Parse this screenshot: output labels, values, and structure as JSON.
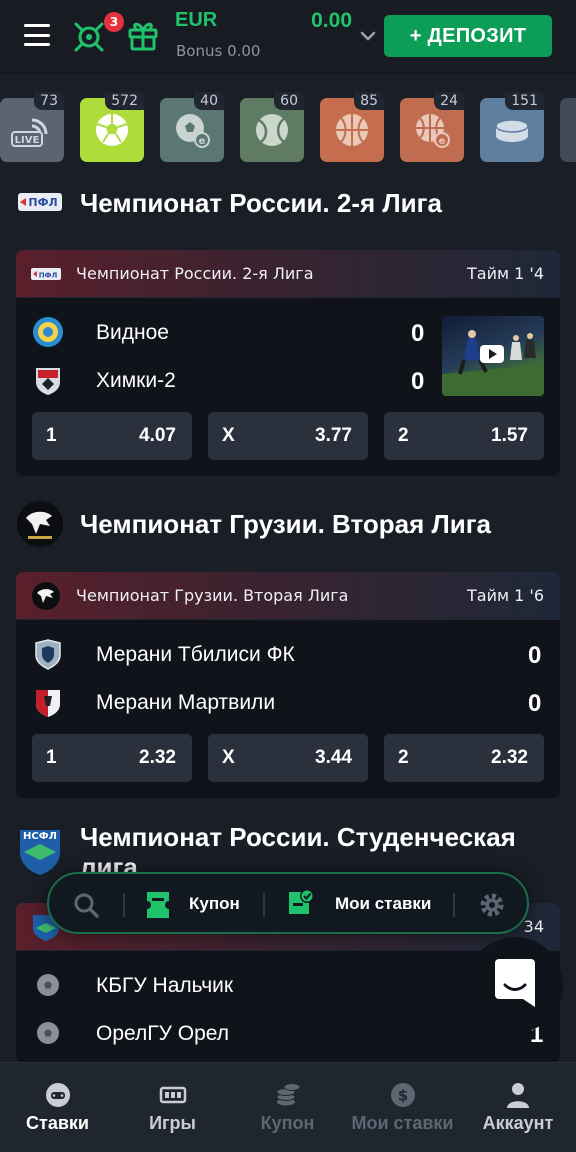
{
  "header": {
    "rewards_badge": "3",
    "currency": "EUR",
    "bonus": "Bonus 0.00",
    "balance": "0.00",
    "deposit_label": "+ ДЕПОЗИТ",
    "accent": "#1fc36b"
  },
  "sports": [
    {
      "icon": "live-icon",
      "count": "73"
    },
    {
      "icon": "football-icon",
      "count": "572"
    },
    {
      "icon": "efootball-icon",
      "count": "40"
    },
    {
      "icon": "tennis-icon",
      "count": "60"
    },
    {
      "icon": "basketball-icon",
      "count": "85"
    },
    {
      "icon": "ebasketball-icon",
      "count": "24"
    },
    {
      "icon": "hockey-icon",
      "count": "151"
    }
  ],
  "leagues": [
    {
      "title": "Чемпионат России. 2-я Лига",
      "card": {
        "league_name": "Чемпионат России. 2-я Лига",
        "period": "Тайм 1 '4",
        "home": {
          "name": "Видное",
          "score": "0"
        },
        "away": {
          "name": "Химки-2",
          "score": "0"
        },
        "odds": [
          {
            "label": "1",
            "value": "4.07"
          },
          {
            "label": "X",
            "value": "3.77"
          },
          {
            "label": "2",
            "value": "1.57"
          }
        ]
      }
    },
    {
      "title": "Чемпионат Грузии. Вторая Лига",
      "card": {
        "league_name": "Чемпионат Грузии. Вторая Лига",
        "period": "Тайм 1 '6",
        "home": {
          "name": "Мерани Тбилиси ФК",
          "score": "0"
        },
        "away": {
          "name": "Мерани Мартвили",
          "score": "0"
        },
        "odds": [
          {
            "label": "1",
            "value": "2.32"
          },
          {
            "label": "X",
            "value": "3.44"
          },
          {
            "label": "2",
            "value": "2.32"
          }
        ]
      }
    },
    {
      "title_line1": "Чемпионат России. Студенческая",
      "title_line2": "лига",
      "card": {
        "period_fragment": "34",
        "home": {
          "name": "КБГУ Нальчик"
        },
        "away": {
          "name": "ОрелГУ Орел",
          "score": "1"
        }
      }
    }
  ],
  "float_bar": {
    "coupon_label": "Купон",
    "my_bets_label": "Мои ставки"
  },
  "bottom_nav": [
    {
      "label": "Ставки",
      "icon": "gamepad-icon",
      "active": true
    },
    {
      "label": "Игры",
      "icon": "slots-icon",
      "active": true
    },
    {
      "label": "Купон",
      "icon": "coins-icon",
      "active": false
    },
    {
      "label": "Мои ставки",
      "icon": "dollar-icon",
      "active": false
    },
    {
      "label": "Аккаунт",
      "icon": "user-icon",
      "active": true
    }
  ]
}
